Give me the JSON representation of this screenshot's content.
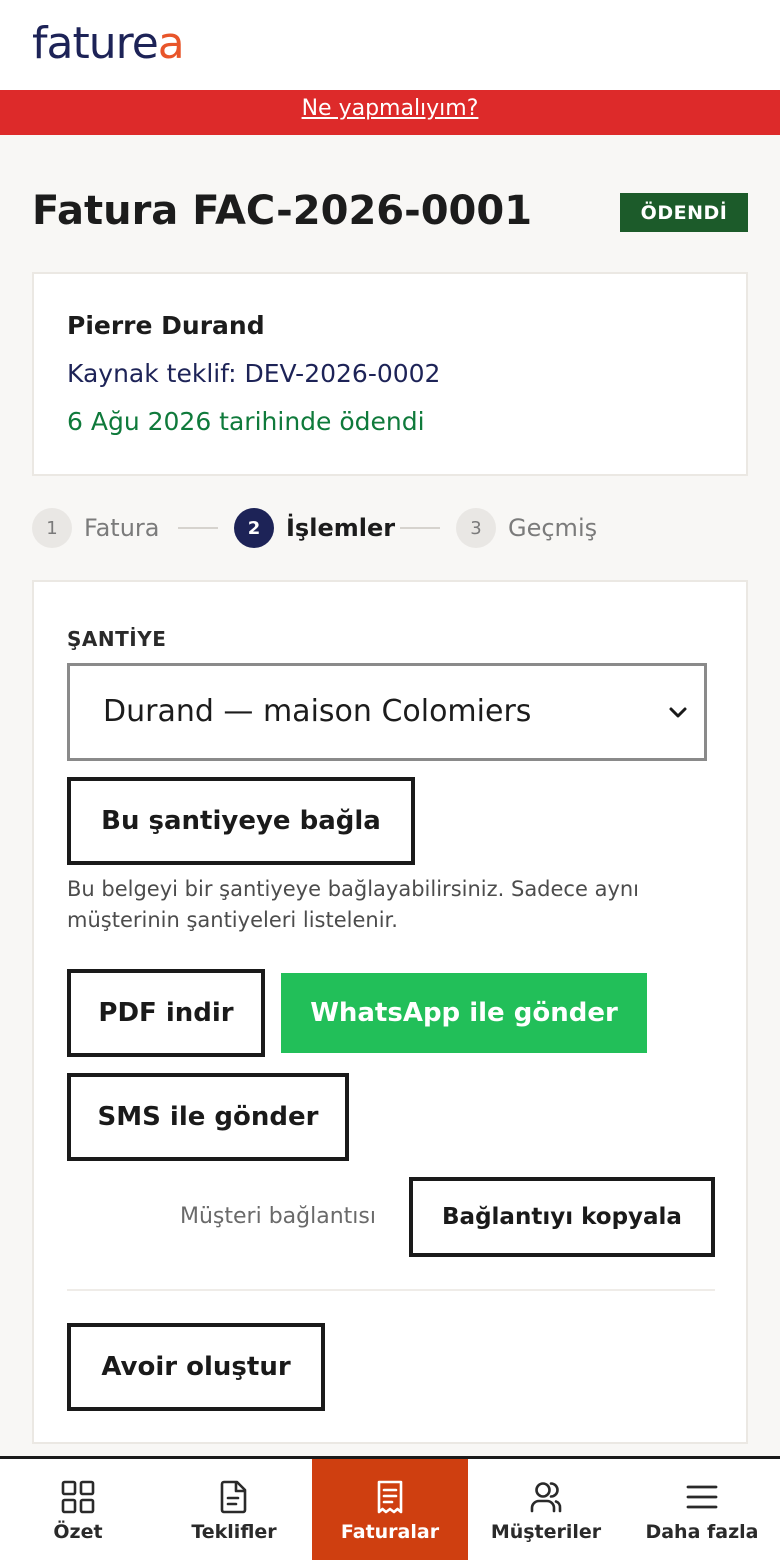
{
  "brand": {
    "name_main": "fature",
    "name_accent": "a"
  },
  "help_bar": {
    "link": "Ne yapmalıyım?"
  },
  "invoice": {
    "title": "Fatura FAC-2026-0001",
    "status": "ÖDENDİ"
  },
  "info": {
    "client": "Pierre Durand",
    "source": "Kaynak teklif: DEV-2026-0002",
    "paid": "6 Ağu 2026 tarihinde ödendi"
  },
  "steps": [
    {
      "num": "1",
      "label": "Fatura",
      "active": false
    },
    {
      "num": "2",
      "label": "İşlemler",
      "active": true
    },
    {
      "num": "3",
      "label": "Geçmiş",
      "active": false
    }
  ],
  "site": {
    "label": "ŞANTİYE",
    "selected": "Durand — maison Colomiers",
    "link_button": "Bu şantiyeye bağla",
    "help": "Bu belgeyi bir şantiyeye bağlayabilirsiniz. Sadece aynı müşterinin şantiyeleri listelenir."
  },
  "actions": {
    "pdf": "PDF indir",
    "whatsapp": "WhatsApp ile gönder",
    "sms": "SMS ile gönder",
    "client_link_label": "Müşteri bağlantısı",
    "copy_link": "Bağlantıyı kopyala",
    "credit_note": "Avoir oluştur"
  },
  "nav": [
    {
      "label": "Özet",
      "icon": "grid-icon",
      "active": false
    },
    {
      "label": "Teklifler",
      "icon": "document-icon",
      "active": false
    },
    {
      "label": "Faturalar",
      "icon": "receipt-icon",
      "active": true
    },
    {
      "label": "Müşteriler",
      "icon": "users-icon",
      "active": false
    },
    {
      "label": "Daha fazla",
      "icon": "menu-icon",
      "active": false
    }
  ],
  "colors": {
    "brand_navy": "#1d2357",
    "brand_orange": "#e8552a",
    "help_red": "#dd2a2a",
    "paid_badge": "#1c5b2a",
    "paid_text": "#0f7a3b",
    "whatsapp_green": "#22bf59",
    "nav_active": "#cf3f10"
  }
}
